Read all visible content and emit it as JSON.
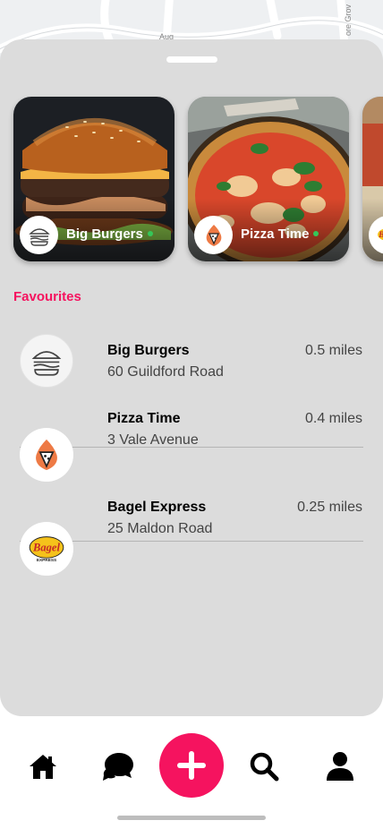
{
  "map": {
    "street_labels": [
      "Aug",
      "ore Grov"
    ]
  },
  "featured": [
    {
      "name": "Big Burgers",
      "logo_icon": "burger-icon",
      "online": true
    },
    {
      "name": "Pizza Time",
      "logo_icon": "pizza-flame-icon",
      "online": true
    },
    {
      "name": "",
      "logo_icon": "bagel-express-logo",
      "online": false
    }
  ],
  "section_title": "Favourites",
  "favourites": [
    {
      "name": "Big Burgers",
      "address": "60 Guildford Road",
      "distance": "0.5 miles",
      "icon": "burger-icon"
    },
    {
      "name": "Pizza Time",
      "address": "3 Vale Avenue",
      "distance": "0.4 miles",
      "icon": "pizza-flame-icon"
    },
    {
      "name": "Bagel Express",
      "address": "25 Maldon Road",
      "distance": "0.25 miles",
      "icon": "bagel-express-logo"
    }
  ],
  "nav": {
    "items": [
      "home-icon",
      "chat-icon",
      "add-icon",
      "search-icon",
      "profile-icon"
    ]
  },
  "colors": {
    "accent": "#f5135f",
    "sheet": "#dcdcdc",
    "online": "#35c759",
    "pizza_orange": "#ee7a45"
  }
}
